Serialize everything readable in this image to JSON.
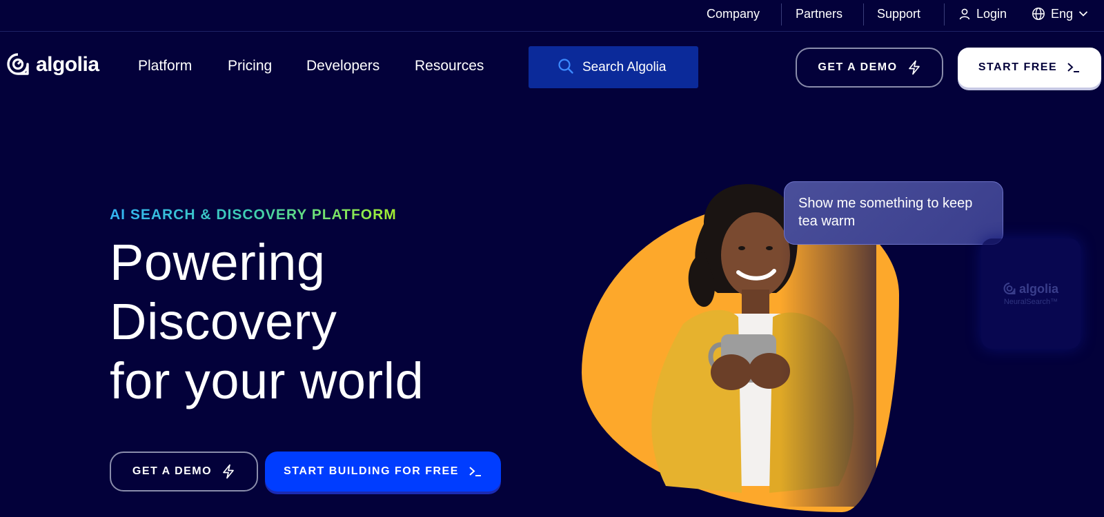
{
  "topbar": {
    "company": "Company",
    "partners": "Partners",
    "support": "Support",
    "login": "Login",
    "language": "Eng"
  },
  "brand": {
    "name": "algolia"
  },
  "nav": {
    "items": [
      {
        "label": "Platform"
      },
      {
        "label": "Pricing"
      },
      {
        "label": "Developers"
      },
      {
        "label": "Resources"
      }
    ],
    "search_label": "Search Algolia",
    "demo_label": "GET A DEMO",
    "start_label": "START FREE"
  },
  "hero": {
    "eyebrow": "AI SEARCH & DISCOVERY PLATFORM",
    "title_lines": [
      "Powering",
      "Discovery",
      "for your world"
    ],
    "demo_label": "GET A DEMO",
    "build_label": "START BUILDING FOR FREE",
    "chat_bubble": "Show me something to keep tea warm",
    "card_brand": "algolia",
    "card_product": "NeuralSearch™"
  },
  "colors": {
    "background": "#03013a",
    "accent_blue": "#003dff",
    "search_bg": "#0b2a9a",
    "orange": "#fda82b"
  },
  "icons": [
    "user-icon",
    "globe-icon",
    "chevron-down-icon",
    "search-icon",
    "lightning-icon",
    "terminal-icon",
    "algolia-logo-icon"
  ]
}
